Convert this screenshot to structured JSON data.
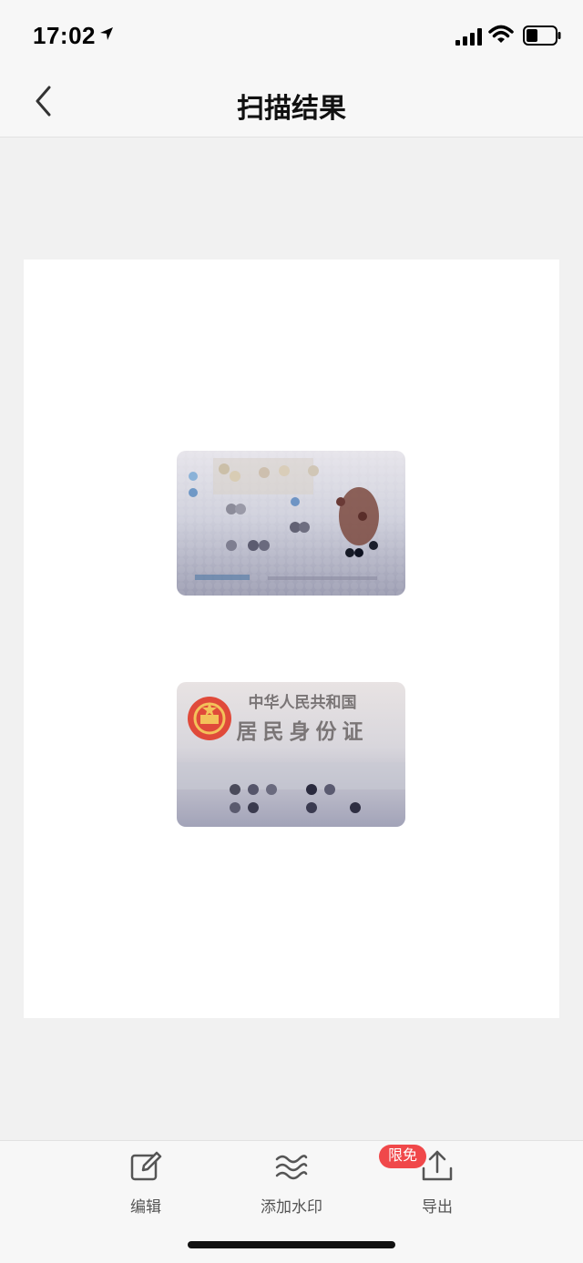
{
  "status_bar": {
    "time": "17:02"
  },
  "nav": {
    "title": "扫描结果"
  },
  "document": {
    "card_back": {
      "line1": "中华人民共和国",
      "line2": "居民身份证"
    }
  },
  "toolbar": {
    "edit_label": "编辑",
    "watermark_label": "添加水印",
    "export_label": "导出",
    "export_badge": "限免"
  },
  "colors": {
    "badge": "#f0484a",
    "icon": "#555555"
  }
}
